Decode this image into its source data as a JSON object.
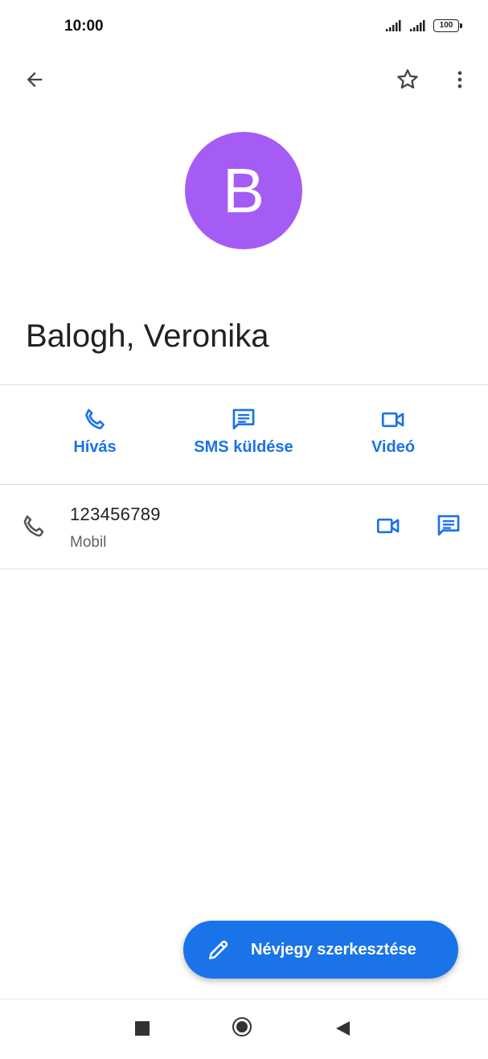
{
  "status_bar": {
    "time": "10:00",
    "battery": "100"
  },
  "contact": {
    "initial": "B",
    "name": "Balogh, Veronika",
    "avatar_color": "#a45cf5"
  },
  "actions": [
    {
      "label": "Hívás",
      "icon": "phone-icon"
    },
    {
      "label": "SMS küldése",
      "icon": "message-icon"
    },
    {
      "label": "Videó",
      "icon": "video-icon"
    }
  ],
  "phone": {
    "number": "123456789",
    "type": "Mobil"
  },
  "fab": {
    "label": "Névjegy szerkesztése",
    "icon": "pencil-icon"
  },
  "colors": {
    "accent": "#1a73e8",
    "text": "#202124",
    "secondary": "#5f6368",
    "divider": "#dadce0"
  }
}
